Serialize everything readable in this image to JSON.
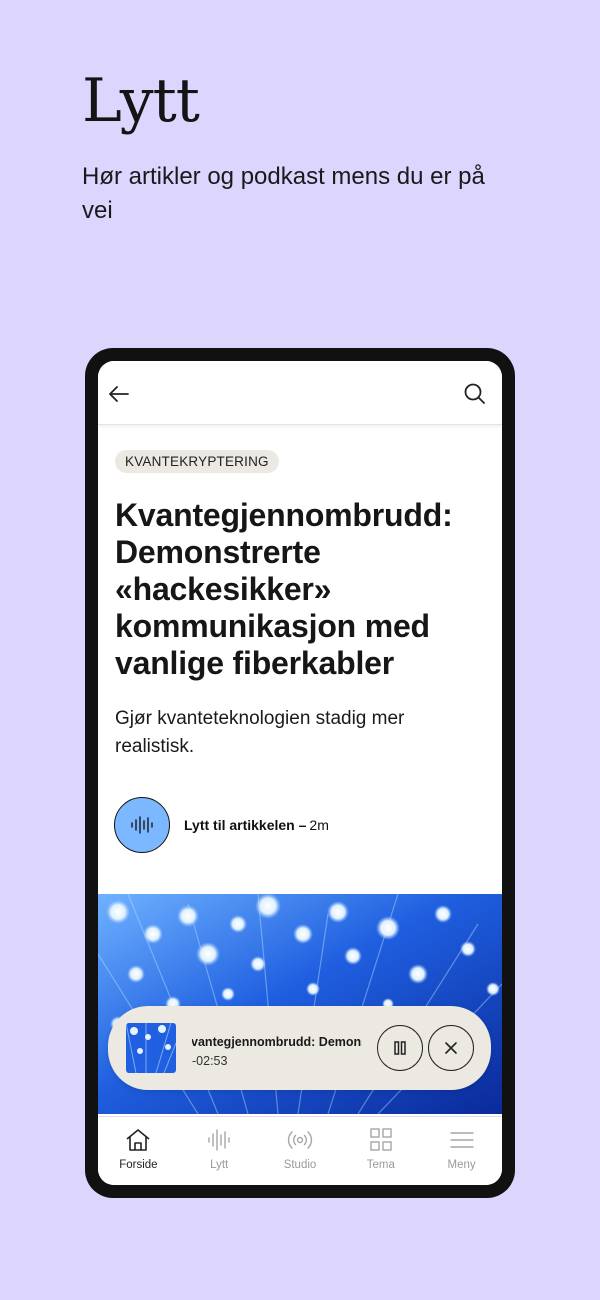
{
  "promo": {
    "title": "Lytt",
    "subtitle": "Hør artikler og podkast mens du er på vei"
  },
  "colors": {
    "background": "#dcd6ff",
    "listen_button": "#7cb8ff",
    "tag_bg": "#ece8e2"
  },
  "article": {
    "tag": "KVANTEKRYPTERING",
    "headline": "Kvantegjennombrudd: Demonstrerte «hackesikker» kommunikasjon med vanlige fiberkabler",
    "lead": "Gjør kvanteteknologien stadig mer realistisk.",
    "listen_label": "Lytt til artikkelen –",
    "listen_duration": "2m"
  },
  "icons": {
    "back": "arrow-left-icon",
    "search": "search-icon",
    "listen": "soundwave-icon",
    "pause": "pause-icon",
    "close": "close-icon"
  },
  "miniplayer": {
    "title": "Kvantegjennombrudd: Demonstrerte «hackesikker»",
    "time_remaining": "-02:53"
  },
  "nav": {
    "items": [
      {
        "label": "Forside",
        "icon": "home-icon",
        "active": true
      },
      {
        "label": "Lytt",
        "icon": "soundwave-icon",
        "active": false
      },
      {
        "label": "Studio",
        "icon": "broadcast-icon",
        "active": false
      },
      {
        "label": "Tema",
        "icon": "grid-icon",
        "active": false
      },
      {
        "label": "Meny",
        "icon": "menu-icon",
        "active": false
      }
    ]
  }
}
